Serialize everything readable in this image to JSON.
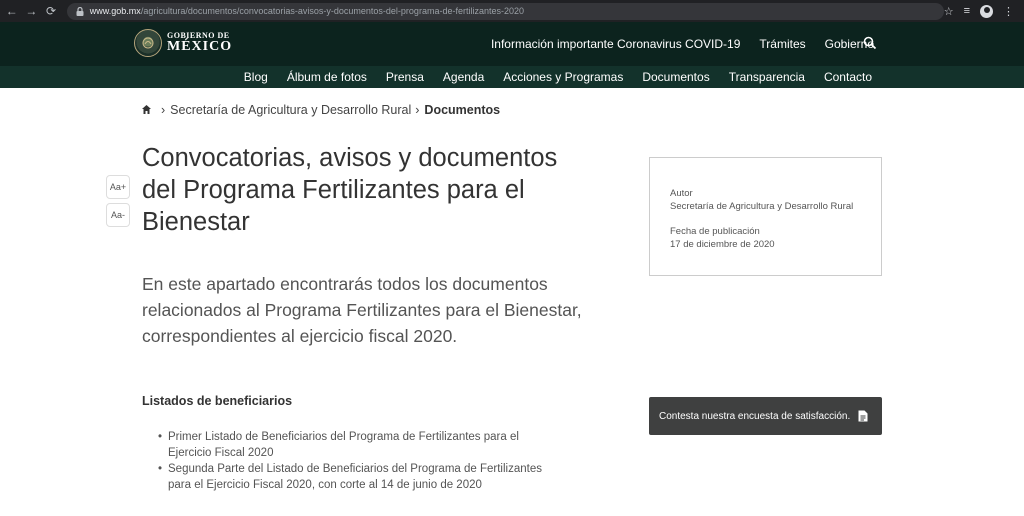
{
  "browser": {
    "url_host": "www.gob.mx",
    "url_path": "/agricultura/documentos/convocatorias-avisos-y-documentos-del-programa-de-fertilizantes-2020"
  },
  "header": {
    "logo_line1": "GOBIERNO DE",
    "logo_line2": "MÉXICO",
    "top_links": [
      "Información importante Coronavirus COVID-19",
      "Trámites",
      "Gobierno"
    ],
    "sub_links": [
      "Blog",
      "Álbum de fotos",
      "Prensa",
      "Agenda",
      "Acciones y Programas",
      "Documentos",
      "Transparencia",
      "Contacto"
    ]
  },
  "breadcrumb": {
    "sep": "›",
    "items": [
      "Secretaría de Agricultura y Desarrollo Rural"
    ],
    "current": "Documentos"
  },
  "font_controls": {
    "increase": "Aa+",
    "decrease": "Aa-"
  },
  "page": {
    "title": "Convocatorias, avisos y documentos del Programa Fertilizantes para el Bienestar",
    "lead": "En este apartado encontrarás todos los documentos relacionados al Programa Fertilizantes para el Bienestar, correspondientes al ejercicio fiscal 2020.",
    "section_heading": "Listados de beneficiarios",
    "documents": [
      "Primer Listado de Beneficiarios del Programa de Fertilizantes para el Ejercicio Fiscal 2020",
      "Segunda Parte del Listado de Beneficiarios del Programa de Fertilizantes para el Ejercicio Fiscal 2020, con corte al 14 de junio de 2020"
    ]
  },
  "info": {
    "author_label": "Autor",
    "author": "Secretaría de Agricultura y Desarrollo Rural",
    "date_label": "Fecha de publicación",
    "date": "17 de diciembre de 2020"
  },
  "survey": {
    "label": "Contesta nuestra encuesta de satisfacción."
  },
  "colors": {
    "header_dark": "#0c231e",
    "header_sub": "#13322b",
    "survey_bg": "#3f4040"
  }
}
